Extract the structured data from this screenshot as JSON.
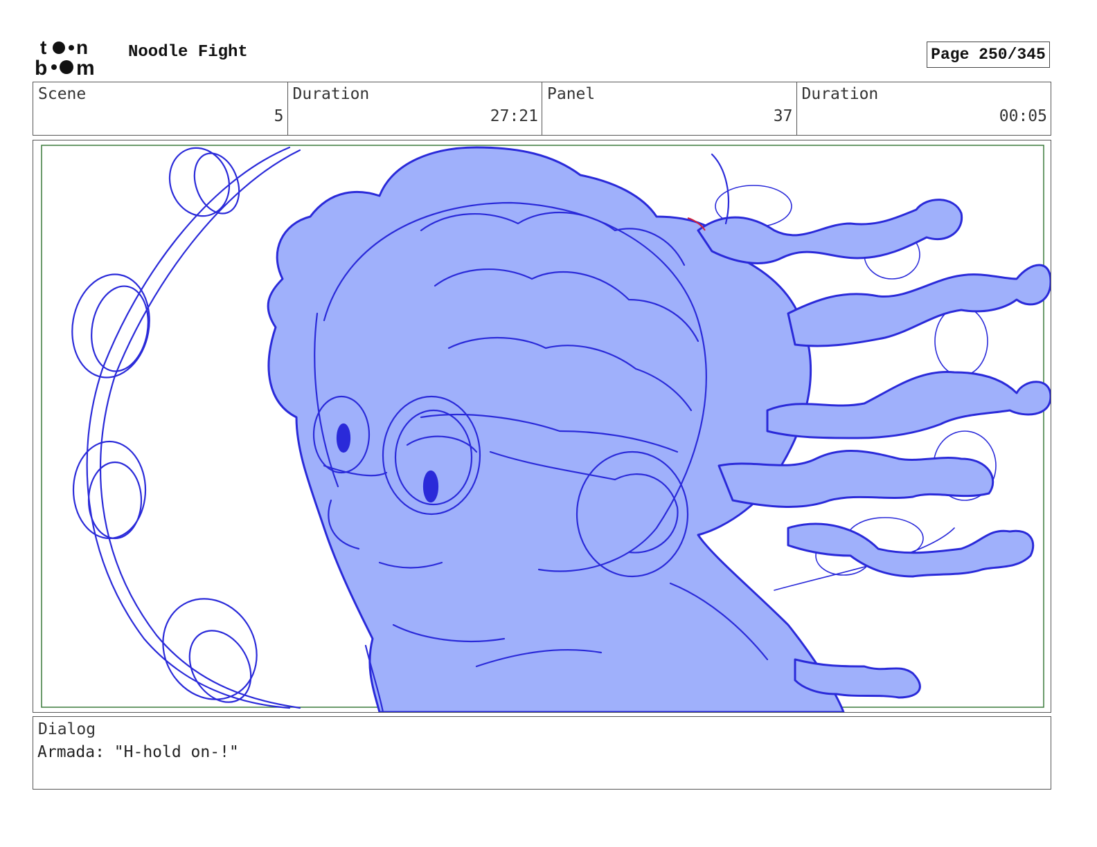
{
  "header": {
    "logo_text_top": "toon",
    "logo_text_bottom": "boom",
    "project_title": "Noodle Fight",
    "page_indicator": "Page 250/345"
  },
  "info": {
    "scene_label": "Scene",
    "scene_value": "5",
    "scene_duration_label": "Duration",
    "scene_duration_value": "27:21",
    "panel_label": "Panel",
    "panel_value": "37",
    "panel_duration_label": "Duration",
    "panel_duration_value": "00:05"
  },
  "dialog": {
    "label": "Dialog",
    "text": "Armada: \"H-hold on-!\""
  },
  "colors": {
    "sketch_line": "#2a2ad9",
    "sketch_fill": "#9fb0fb",
    "safe_frame": "#3a7a3a",
    "accent_red": "#d0203a"
  }
}
